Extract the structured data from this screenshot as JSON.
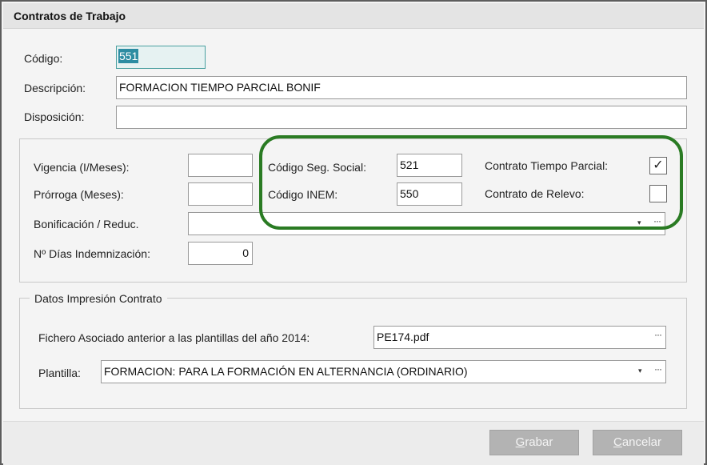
{
  "window": {
    "title": "Contratos de Trabajo"
  },
  "header_fields": {
    "codigo": {
      "label": "Código:",
      "value": "551"
    },
    "descripcion": {
      "label": "Descripción:",
      "value": "FORMACION TIEMPO PARCIAL BONIF"
    },
    "disposicion": {
      "label": "Disposición:",
      "value": ""
    }
  },
  "params": {
    "vigencia": {
      "label": "Vigencia (I/Meses):",
      "value": ""
    },
    "prorroga": {
      "label": "Prórroga (Meses):",
      "value": ""
    },
    "bonificacion": {
      "label": "Bonificación / Reduc.",
      "value": ""
    },
    "dias_indemnizacion": {
      "label": "Nº Días Indemnización:",
      "value": "0"
    },
    "codigo_seg_social": {
      "label": "Código Seg. Social:",
      "value": "521"
    },
    "codigo_inem": {
      "label": "Código INEM:",
      "value": "550"
    },
    "contrato_tiempo_parcial": {
      "label": "Contrato Tiempo Parcial:",
      "checked": true,
      "mark": "✓"
    },
    "contrato_relevo": {
      "label": "Contrato de Relevo:",
      "checked": false,
      "mark": ""
    }
  },
  "impresion": {
    "legend": "Datos Impresión Contrato",
    "fichero": {
      "label": "Fichero Asociado anterior a las plantillas del año 2014:",
      "value": "PE174.pdf"
    },
    "plantilla": {
      "label": "Plantilla:",
      "value": "FORMACION: PARA LA FORMACIÓN EN ALTERNANCIA (ORDINARIO)"
    }
  },
  "controls": {
    "dropdown_glyph": "▾",
    "ellipsis_glyph": "···"
  },
  "buttons": {
    "grabar": {
      "mnemonic": "G",
      "rest": "rabar"
    },
    "cancelar": {
      "mnemonic": "C",
      "rest": "ancelar"
    }
  },
  "colors": {
    "highlight": "#2a7b23",
    "selection": "#2c8ca2",
    "button_disabled": "#b3b3b3"
  }
}
